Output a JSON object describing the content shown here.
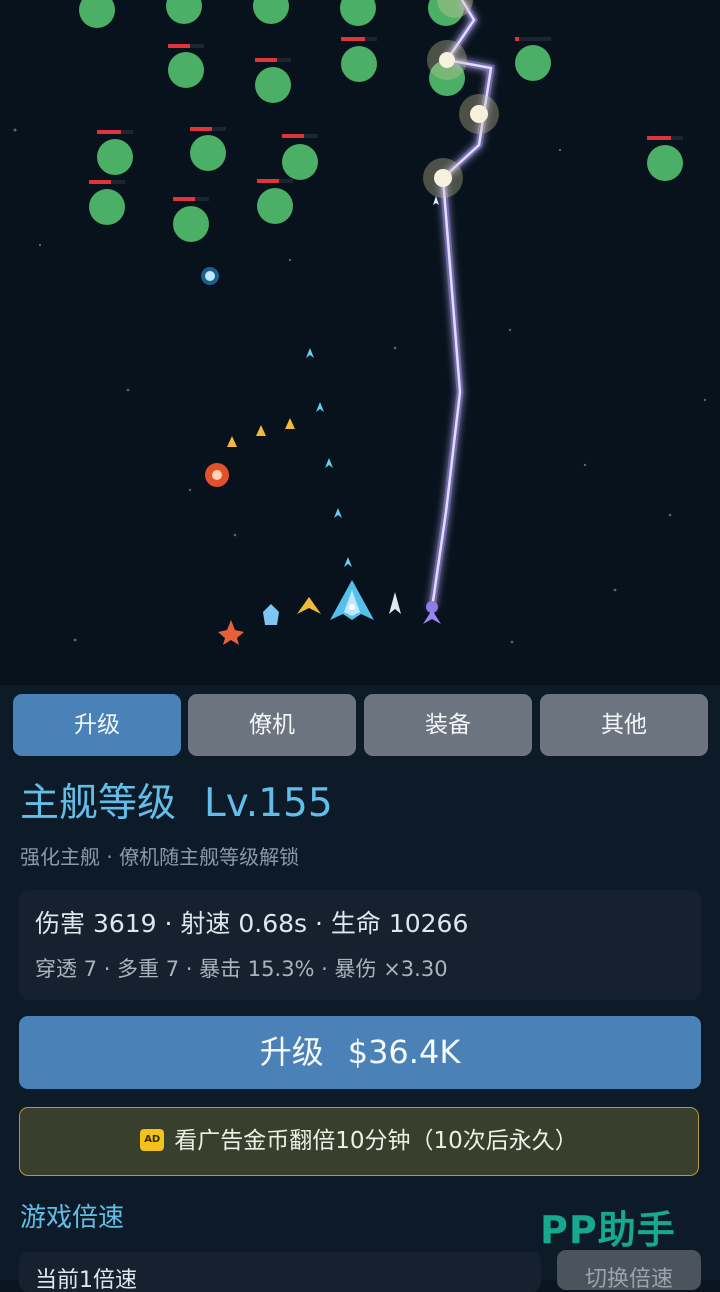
{
  "tabs": [
    {
      "label": "升级",
      "active": true
    },
    {
      "label": "僚机",
      "active": false
    },
    {
      "label": "装备",
      "active": false
    },
    {
      "label": "其他",
      "active": false
    }
  ],
  "ship": {
    "title": "主舰等级",
    "level": "Lv.155",
    "subtitle": "强化主舰 · 僚机随主舰等级解锁"
  },
  "stats": {
    "line1": "伤害 3619 · 射速 0.68s · 生命 10266",
    "line2": "穿透 7 · 多重 7 · 暴击 15.3% · 暴伤 ×3.30"
  },
  "upgrade": {
    "label": "升级",
    "cost": "$36.4K"
  },
  "ad": {
    "badge": "AD",
    "text": "看广告金币翻倍10分钟（10次后永久）"
  },
  "speed": {
    "section_label": "游戏倍速",
    "current": "当前1倍速",
    "switch_label": "切换倍速"
  },
  "watermark": "PP助手",
  "colors": {
    "accent": "#63bde9",
    "primary_button": "#4a82b8",
    "tab_inactive": "#6b747f",
    "enemy": "#4caf66",
    "enemy_health": "#e0343c",
    "lightning": "#b59cff",
    "ad_border": "#b7982f",
    "watermark": "#17a98f"
  }
}
